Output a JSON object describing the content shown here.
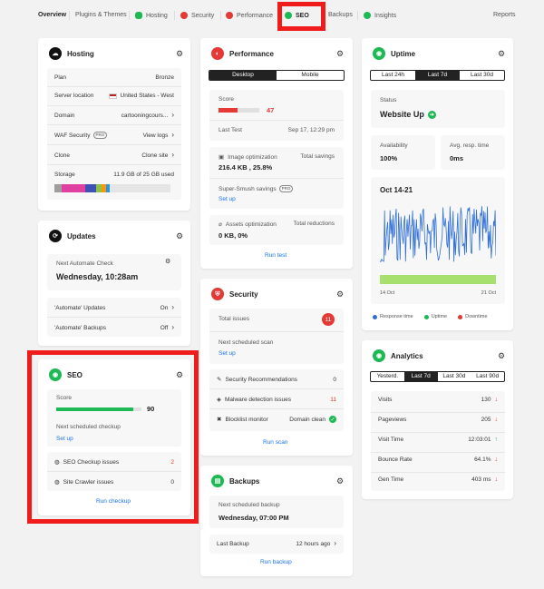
{
  "nav": {
    "overview": "Overview",
    "plugins": "Plugins & Themes",
    "hosting": "Hosting",
    "security": "Security",
    "performance": "Performance",
    "seo": "SEO",
    "backups": "Backups",
    "insights": "Insights",
    "reports": "Reports"
  },
  "colors": {
    "accent_red": "#e53935",
    "green": "#1db954",
    "highlight": "#f01c1c",
    "chart_blue": "#2f6fd6",
    "chart_green": "#a7e06e"
  },
  "hosting": {
    "title": "Hosting",
    "plan_label": "Plan",
    "plan_value": "Bronze",
    "server_label": "Server location",
    "server_value": "United States - West",
    "domain_label": "Domain",
    "domain_value": "cartooningcours...",
    "waf_label": "WAF Security",
    "waf_pill": "PRO",
    "waf_value": "View logs",
    "clone_label": "Clone",
    "clone_value": "Clone site",
    "storage_label": "Storage",
    "storage_value": "11.9 GB of 25 GB used",
    "storage_fraction": 0.476
  },
  "updates": {
    "title": "Updates",
    "next_label": "Next Automate Check",
    "next_value": "Wednesday, 10:28am",
    "auto_updates_label": "'Automate' Updates",
    "auto_updates_value": "On",
    "auto_backups_label": "'Automate' Backups",
    "auto_backups_value": "Off"
  },
  "seo": {
    "title": "SEO",
    "score_label": "Score",
    "score_value": "90",
    "score_fraction": 0.9,
    "next_label": "Next scheduled checkup",
    "next_link": "Set up",
    "checkup_label": "SEO Checkup issues",
    "checkup_value": "2",
    "crawler_label": "Site Crawler issues",
    "crawler_value": "0",
    "run": "Run checkup"
  },
  "performance": {
    "title": "Performance",
    "tabs": [
      "Desktop",
      "Mobile"
    ],
    "score_label": "Score",
    "score_value": "47",
    "score_fraction": 0.47,
    "last_test_label": "Last Test",
    "last_test_value": "Sep 17, 12:29 pm",
    "img_label": "Image optimization",
    "img_savings_label": "Total savings",
    "img_value": "216.4 KB , 25.8%",
    "smush_label": "Super-Smush savings",
    "smush_pill": "PRO",
    "smush_link": "Set up",
    "assets_label": "Assets optimization",
    "assets_red_label": "Total reductions",
    "assets_value": "0 KB, 0%",
    "run": "Run test"
  },
  "security": {
    "title": "Security",
    "total_label": "Total issues",
    "total_value": "11",
    "next_label": "Next scheduled scan",
    "next_link": "Set up",
    "rec_label": "Security Recommendations",
    "rec_value": "0",
    "malware_label": "Malware detection issues",
    "malware_value": "11",
    "blocklist_label": "Blocklist monitor",
    "blocklist_value": "Domain clean",
    "run": "Run scan"
  },
  "backups": {
    "title": "Backups",
    "next_label": "Next scheduled backup",
    "next_value": "Wednesday, 07:00 PM",
    "last_label": "Last Backup",
    "last_value": "12 hours ago",
    "run": "Run backup"
  },
  "uptime": {
    "title": "Uptime",
    "tabs": [
      "Last 24h",
      "Last 7d",
      "Last 30d"
    ],
    "status_label": "Status",
    "status_value": "Website Up",
    "avail_label": "Availability",
    "avail_value": "100%",
    "resp_label": "Avg. resp. time",
    "resp_value": "0ms",
    "chart_title": "Oct 14-21",
    "x_start": "14 Oct",
    "x_end": "21 Oct",
    "legend": [
      "Response time",
      "Uptime",
      "Downtime"
    ]
  },
  "analytics": {
    "title": "Analytics",
    "tabs": [
      "Yesterd.",
      "Last 7d",
      "Last 30d",
      "Last 90d"
    ],
    "rows": [
      {
        "label": "Visits",
        "value": "130",
        "trend": "down"
      },
      {
        "label": "Pageviews",
        "value": "205",
        "trend": "down"
      },
      {
        "label": "Visit Time",
        "value": "12:03:01",
        "trend": "up"
      },
      {
        "label": "Bounce Rate",
        "value": "64.1%",
        "trend": "down"
      },
      {
        "label": "Gen Time",
        "value": "403 ms",
        "trend": "down"
      }
    ]
  }
}
